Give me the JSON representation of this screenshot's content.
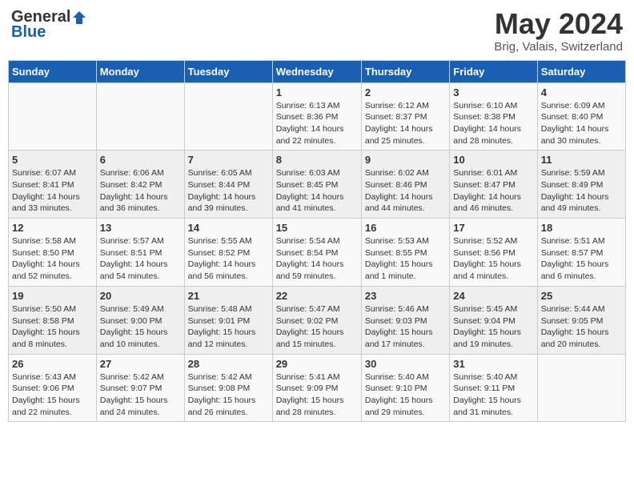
{
  "header": {
    "logo_general": "General",
    "logo_blue": "Blue",
    "month_title": "May 2024",
    "location": "Brig, Valais, Switzerland"
  },
  "weekdays": [
    "Sunday",
    "Monday",
    "Tuesday",
    "Wednesday",
    "Thursday",
    "Friday",
    "Saturday"
  ],
  "weeks": [
    [
      {
        "day": "",
        "info": ""
      },
      {
        "day": "",
        "info": ""
      },
      {
        "day": "",
        "info": ""
      },
      {
        "day": "1",
        "info": "Sunrise: 6:13 AM\nSunset: 8:36 PM\nDaylight: 14 hours\nand 22 minutes."
      },
      {
        "day": "2",
        "info": "Sunrise: 6:12 AM\nSunset: 8:37 PM\nDaylight: 14 hours\nand 25 minutes."
      },
      {
        "day": "3",
        "info": "Sunrise: 6:10 AM\nSunset: 8:38 PM\nDaylight: 14 hours\nand 28 minutes."
      },
      {
        "day": "4",
        "info": "Sunrise: 6:09 AM\nSunset: 8:40 PM\nDaylight: 14 hours\nand 30 minutes."
      }
    ],
    [
      {
        "day": "5",
        "info": "Sunrise: 6:07 AM\nSunset: 8:41 PM\nDaylight: 14 hours\nand 33 minutes."
      },
      {
        "day": "6",
        "info": "Sunrise: 6:06 AM\nSunset: 8:42 PM\nDaylight: 14 hours\nand 36 minutes."
      },
      {
        "day": "7",
        "info": "Sunrise: 6:05 AM\nSunset: 8:44 PM\nDaylight: 14 hours\nand 39 minutes."
      },
      {
        "day": "8",
        "info": "Sunrise: 6:03 AM\nSunset: 8:45 PM\nDaylight: 14 hours\nand 41 minutes."
      },
      {
        "day": "9",
        "info": "Sunrise: 6:02 AM\nSunset: 8:46 PM\nDaylight: 14 hours\nand 44 minutes."
      },
      {
        "day": "10",
        "info": "Sunrise: 6:01 AM\nSunset: 8:47 PM\nDaylight: 14 hours\nand 46 minutes."
      },
      {
        "day": "11",
        "info": "Sunrise: 5:59 AM\nSunset: 8:49 PM\nDaylight: 14 hours\nand 49 minutes."
      }
    ],
    [
      {
        "day": "12",
        "info": "Sunrise: 5:58 AM\nSunset: 8:50 PM\nDaylight: 14 hours\nand 52 minutes."
      },
      {
        "day": "13",
        "info": "Sunrise: 5:57 AM\nSunset: 8:51 PM\nDaylight: 14 hours\nand 54 minutes."
      },
      {
        "day": "14",
        "info": "Sunrise: 5:55 AM\nSunset: 8:52 PM\nDaylight: 14 hours\nand 56 minutes."
      },
      {
        "day": "15",
        "info": "Sunrise: 5:54 AM\nSunset: 8:54 PM\nDaylight: 14 hours\nand 59 minutes."
      },
      {
        "day": "16",
        "info": "Sunrise: 5:53 AM\nSunset: 8:55 PM\nDaylight: 15 hours\nand 1 minute."
      },
      {
        "day": "17",
        "info": "Sunrise: 5:52 AM\nSunset: 8:56 PM\nDaylight: 15 hours\nand 4 minutes."
      },
      {
        "day": "18",
        "info": "Sunrise: 5:51 AM\nSunset: 8:57 PM\nDaylight: 15 hours\nand 6 minutes."
      }
    ],
    [
      {
        "day": "19",
        "info": "Sunrise: 5:50 AM\nSunset: 8:58 PM\nDaylight: 15 hours\nand 8 minutes."
      },
      {
        "day": "20",
        "info": "Sunrise: 5:49 AM\nSunset: 9:00 PM\nDaylight: 15 hours\nand 10 minutes."
      },
      {
        "day": "21",
        "info": "Sunrise: 5:48 AM\nSunset: 9:01 PM\nDaylight: 15 hours\nand 12 minutes."
      },
      {
        "day": "22",
        "info": "Sunrise: 5:47 AM\nSunset: 9:02 PM\nDaylight: 15 hours\nand 15 minutes."
      },
      {
        "day": "23",
        "info": "Sunrise: 5:46 AM\nSunset: 9:03 PM\nDaylight: 15 hours\nand 17 minutes."
      },
      {
        "day": "24",
        "info": "Sunrise: 5:45 AM\nSunset: 9:04 PM\nDaylight: 15 hours\nand 19 minutes."
      },
      {
        "day": "25",
        "info": "Sunrise: 5:44 AM\nSunset: 9:05 PM\nDaylight: 15 hours\nand 20 minutes."
      }
    ],
    [
      {
        "day": "26",
        "info": "Sunrise: 5:43 AM\nSunset: 9:06 PM\nDaylight: 15 hours\nand 22 minutes."
      },
      {
        "day": "27",
        "info": "Sunrise: 5:42 AM\nSunset: 9:07 PM\nDaylight: 15 hours\nand 24 minutes."
      },
      {
        "day": "28",
        "info": "Sunrise: 5:42 AM\nSunset: 9:08 PM\nDaylight: 15 hours\nand 26 minutes."
      },
      {
        "day": "29",
        "info": "Sunrise: 5:41 AM\nSunset: 9:09 PM\nDaylight: 15 hours\nand 28 minutes."
      },
      {
        "day": "30",
        "info": "Sunrise: 5:40 AM\nSunset: 9:10 PM\nDaylight: 15 hours\nand 29 minutes."
      },
      {
        "day": "31",
        "info": "Sunrise: 5:40 AM\nSunset: 9:11 PM\nDaylight: 15 hours\nand 31 minutes."
      },
      {
        "day": "",
        "info": ""
      }
    ]
  ]
}
